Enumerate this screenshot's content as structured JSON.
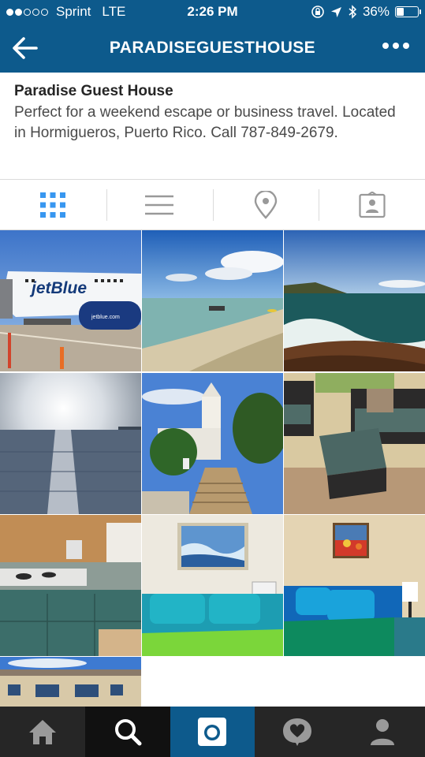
{
  "status_bar": {
    "carrier": "Sprint",
    "network": "LTE",
    "time": "2:26 PM",
    "battery": "36%",
    "battery_level": 0.36,
    "signal_bars_filled": 2,
    "signal_bars_total": 5
  },
  "nav": {
    "title": "PARADISEGUESTHOUSE",
    "back_icon": "arrow-left-icon",
    "more_icon": "more-dots-icon"
  },
  "bio": {
    "name": "Paradise Guest House",
    "text": "Perfect for a weekend escape or business travel. Located in Hormigueros, Puerto Rico. Call 787-849-2679."
  },
  "tabs": [
    {
      "icon": "grid-view-icon",
      "active": true
    },
    {
      "icon": "list-view-icon",
      "active": false
    },
    {
      "icon": "location-pin-icon",
      "active": false
    },
    {
      "icon": "tagged-photos-icon",
      "active": false
    }
  ],
  "photos": [
    {
      "subject": "jetBlue airplane at gate",
      "airline_text": "jetBlue",
      "url_text": "jetblue.com"
    },
    {
      "subject": "beach with boats"
    },
    {
      "subject": "rocky coastline with waves"
    },
    {
      "subject": "sunset over water"
    },
    {
      "subject": "white church tower and stairs"
    },
    {
      "subject": "patio furniture with cushions"
    },
    {
      "subject": "kitchenette counter with stove"
    },
    {
      "subject": "bedroom with wave painting"
    },
    {
      "subject": "bedroom with flower painting and lamp"
    },
    {
      "subject": "guest house building exterior"
    }
  ],
  "bottom_nav": [
    {
      "icon": "home-icon"
    },
    {
      "icon": "search-icon",
      "active": true
    },
    {
      "icon": "camera-icon"
    },
    {
      "icon": "activity-heart-icon"
    },
    {
      "icon": "profile-icon"
    }
  ],
  "colors": {
    "brand_blue": "#0d5a8c",
    "active_tab": "#3897f0",
    "inactive_tab": "#999999",
    "bottom_bar": "#262626"
  }
}
